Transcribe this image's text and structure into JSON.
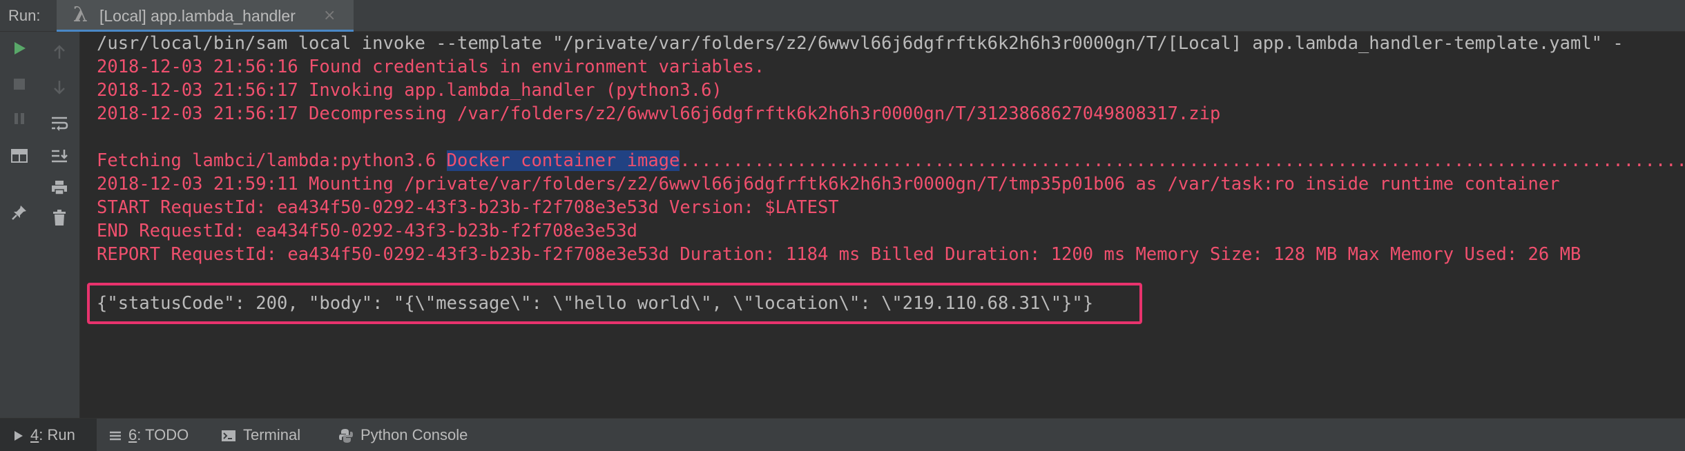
{
  "tool_window": {
    "run_label": "Run:",
    "tab": {
      "title": "[Local] app.lambda_handler",
      "close": "×"
    }
  },
  "console": {
    "lines": [
      "/usr/local/bin/sam local invoke --template \"/private/var/folders/z2/6wwvl66j6dgfrftk6k2h6h3r0000gn/T/[Local] app.lambda_handler-template.yaml\" -",
      "2018-12-03 21:56:16 Found credentials in environment variables.",
      "2018-12-03 21:56:17 Invoking app.lambda_handler (python3.6)",
      "2018-12-03 21:56:17 Decompressing /var/folders/z2/6wwvl66j6dgfrftk6k2h6h3r0000gn/T/3123868627049808317.zip",
      "2018-12-03 21:59:11 Mounting /private/var/folders/z2/6wwvl66j6dgfrftk6k2h6h3r0000gn/T/tmp35p01b06 as /var/task:ro inside runtime container",
      "START RequestId: ea434f50-0292-43f3-b23b-f2f708e3e53d Version: $LATEST",
      "END RequestId: ea434f50-0292-43f3-b23b-f2f708e3e53d",
      "REPORT RequestId: ea434f50-0292-43f3-b23b-f2f708e3e53d Duration: 1184 ms Billed Duration: 1200 ms Memory Size: 128 MB Max Memory Used: 26 MB",
      "{\"statusCode\": 200, \"body\": \"{\\\"message\\\": \\\"hello world\\\", \\\"location\\\": \\\"219.110.68.31\\\"}\"}"
    ],
    "fetch_line": {
      "prefix": "Fetching lambci/lambda:python3.6 ",
      "selected": "Docker container image",
      "suffix": "................................................................................................................................................"
    }
  },
  "bottom_tabs": [
    {
      "num": "4",
      "label": ": Run"
    },
    {
      "num": "6",
      "label": ": TODO"
    },
    {
      "label": "Terminal"
    },
    {
      "label": "Python Console"
    }
  ],
  "colors": {
    "error_red": "#f0506e",
    "highlight_box": "#e8336d",
    "selection": "#214283",
    "run_green": "#59a869"
  }
}
